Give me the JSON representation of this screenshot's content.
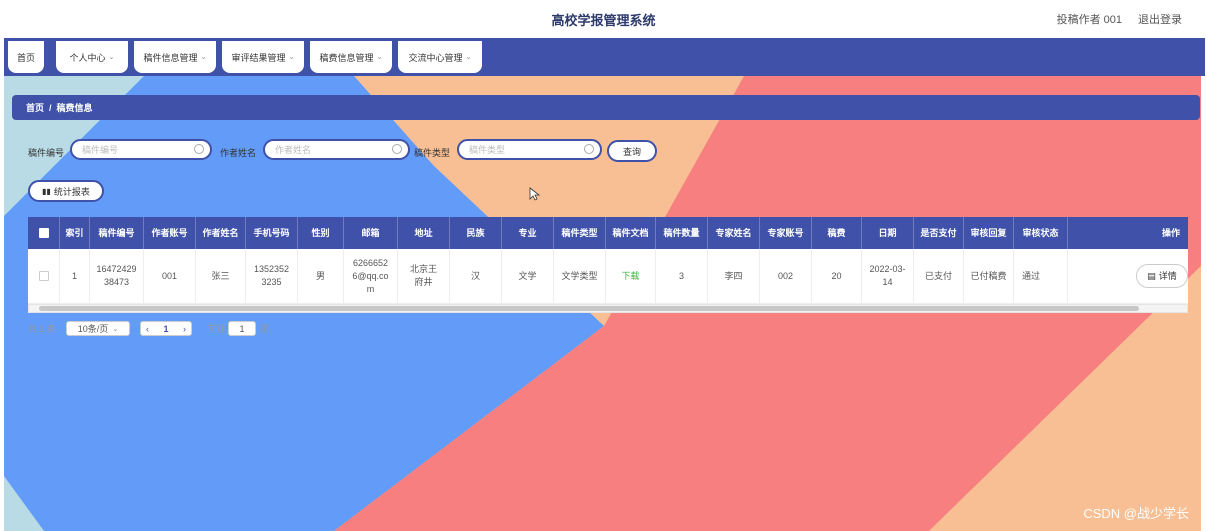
{
  "header": {
    "title": "高校学报管理系统",
    "user": "投稿作者 001",
    "logout": "退出登录"
  },
  "nav": [
    {
      "label": "首页",
      "chevron": false
    },
    {
      "label": "个人中心",
      "chevron": true
    },
    {
      "label": "稿件信息管理",
      "chevron": true
    },
    {
      "label": "审评结果管理",
      "chevron": true
    },
    {
      "label": "稿费信息管理",
      "chevron": true
    },
    {
      "label": "交流中心管理",
      "chevron": true
    }
  ],
  "breadcrumb": {
    "home": "首页",
    "sep": "/",
    "current": "稿费信息"
  },
  "search": {
    "label1": "稿件编号",
    "placeholder1": "稿件编号",
    "label2": "作者姓名",
    "placeholder2": "作者姓名",
    "label3": "稿件类型",
    "placeholder3": "稿件类型",
    "query_button": "查询"
  },
  "report_button": "统计报表",
  "table": {
    "columns": [
      "索引",
      "稿件编号",
      "作者账号",
      "作者姓名",
      "手机号码",
      "性别",
      "邮箱",
      "地址",
      "民族",
      "专业",
      "稿件类型",
      "稿件文档",
      "稿件数量",
      "专家姓名",
      "专家账号",
      "稿费",
      "日期",
      "是否支付",
      "审核回复",
      "审核状态",
      "操作"
    ],
    "rows": [
      {
        "index": "1",
        "manuscript_no": "1647242938473",
        "author_account": "001",
        "author_name": "张三",
        "phone": "13523523235",
        "gender": "男",
        "email": "62666526@qq.com",
        "address": "北京王府井",
        "ethnicity": "汉",
        "major": "文学",
        "type": "文学类型",
        "document": "下载",
        "count": "3",
        "expert_name": "李四",
        "expert_account": "002",
        "fee": "20",
        "date": "2022-03-14",
        "paid": "已支付",
        "review_reply": "已付稿费",
        "review_status": "通过",
        "action": "详情"
      }
    ]
  },
  "pagination": {
    "total": "共 1 条",
    "page_size": "10条/页",
    "current_page": "1",
    "goto_label": "前往",
    "goto_value": "1",
    "page_unit": "页"
  },
  "watermark": "CSDN @战少学长",
  "colors": {
    "primary": "#3f51a8",
    "bg_blue": "#629bf8",
    "bg_coral": "#f77f7f",
    "bg_peach": "#f7bf93",
    "bg_lightblue": "#b9dbe5",
    "link_green": "#3ab53a"
  }
}
